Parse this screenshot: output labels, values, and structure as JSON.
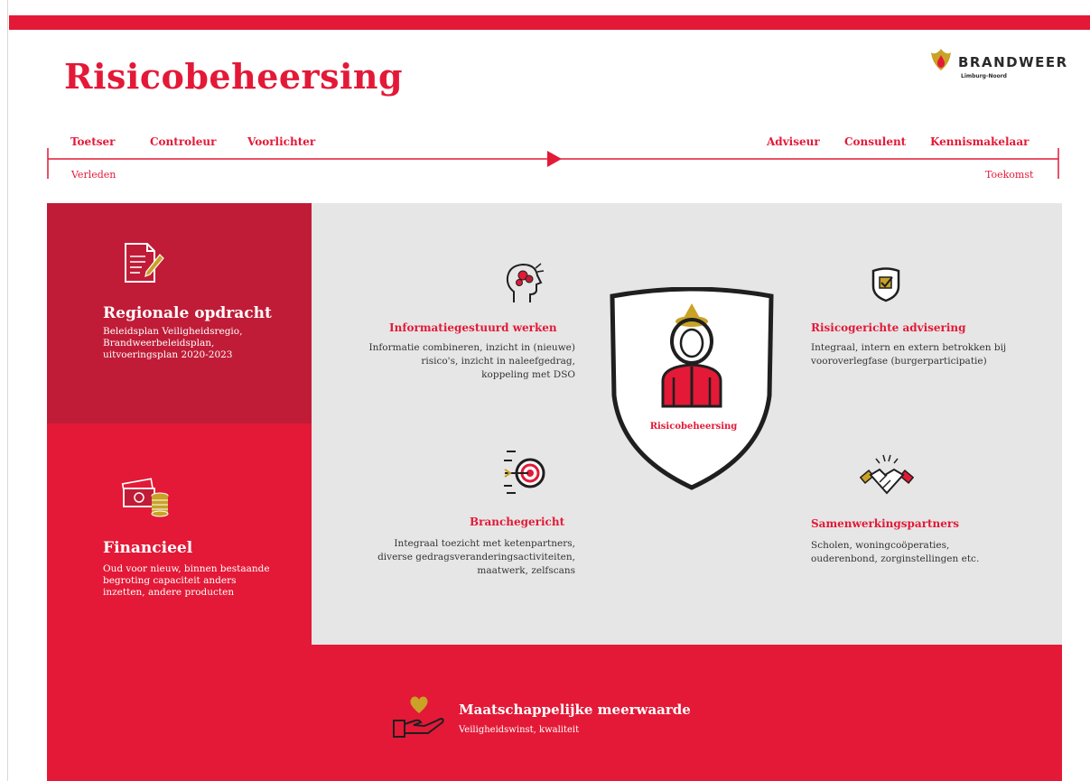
{
  "header": {
    "title": "Risicobeheersing",
    "logo_name": "BRANDWEER",
    "logo_sub": "Limburg-Noord"
  },
  "timeline": {
    "roles_left": [
      "Toetser",
      "Controleur",
      "Voorlichter"
    ],
    "roles_right": [
      "Adviseur",
      "Consulent",
      "Kennismakelaar"
    ],
    "start_label": "Verleden",
    "end_label": "Toekomst"
  },
  "left_panels": {
    "regional": {
      "icon": "document-pen-icon",
      "title": "Regionale opdracht",
      "body": "Beleidsplan Veiligheidsregio,\nBrandweerbeleidsplan,\nuitvoeringsplan 2020-2023"
    },
    "financial": {
      "icon": "money-coins-icon",
      "title": "Financieel",
      "body": "Oud voor nieuw, binnen bestaande\nbegroting capaciteit anders\ninzetten, andere producten"
    }
  },
  "center": {
    "shield_label": "Risicobeheersing",
    "shield_icon": "firefighter-icon",
    "items": [
      {
        "icon": "head-brain-icon",
        "title": "Informatiegestuurd werken",
        "body": "Informatie combineren, inzicht in (nieuwe)\nrisico's, inzicht in naleefgedrag,\nkoppeling met DSO"
      },
      {
        "icon": "shield-check-icon",
        "title": "Risicogerichte advisering",
        "body": "Integraal, intern en extern betrokken bij\nvooroverlegfase (burgerparticipatie)"
      },
      {
        "icon": "target-arrow-icon",
        "title": "Branchegericht",
        "body": "Integraal toezicht met ketenpartners,\ndiverse gedragsveranderingsactiviteiten,\nmaatwerk, zelfscans"
      },
      {
        "icon": "handshake-icon",
        "title": "Samenwerkingspartners",
        "body": "Scholen, woningcoöperaties,\nouderenbond, zorginstellingen etc."
      }
    ]
  },
  "bottom": {
    "icon": "heart-hand-icon",
    "title": "Maatschappelijke meerwaarde",
    "body": "Veiligheidswinst, kwaliteit"
  },
  "colors": {
    "brand_red": "#e31937",
    "dark_red": "#c01c37",
    "grey_panel": "#e6e6e6",
    "gold": "#c9a227"
  }
}
